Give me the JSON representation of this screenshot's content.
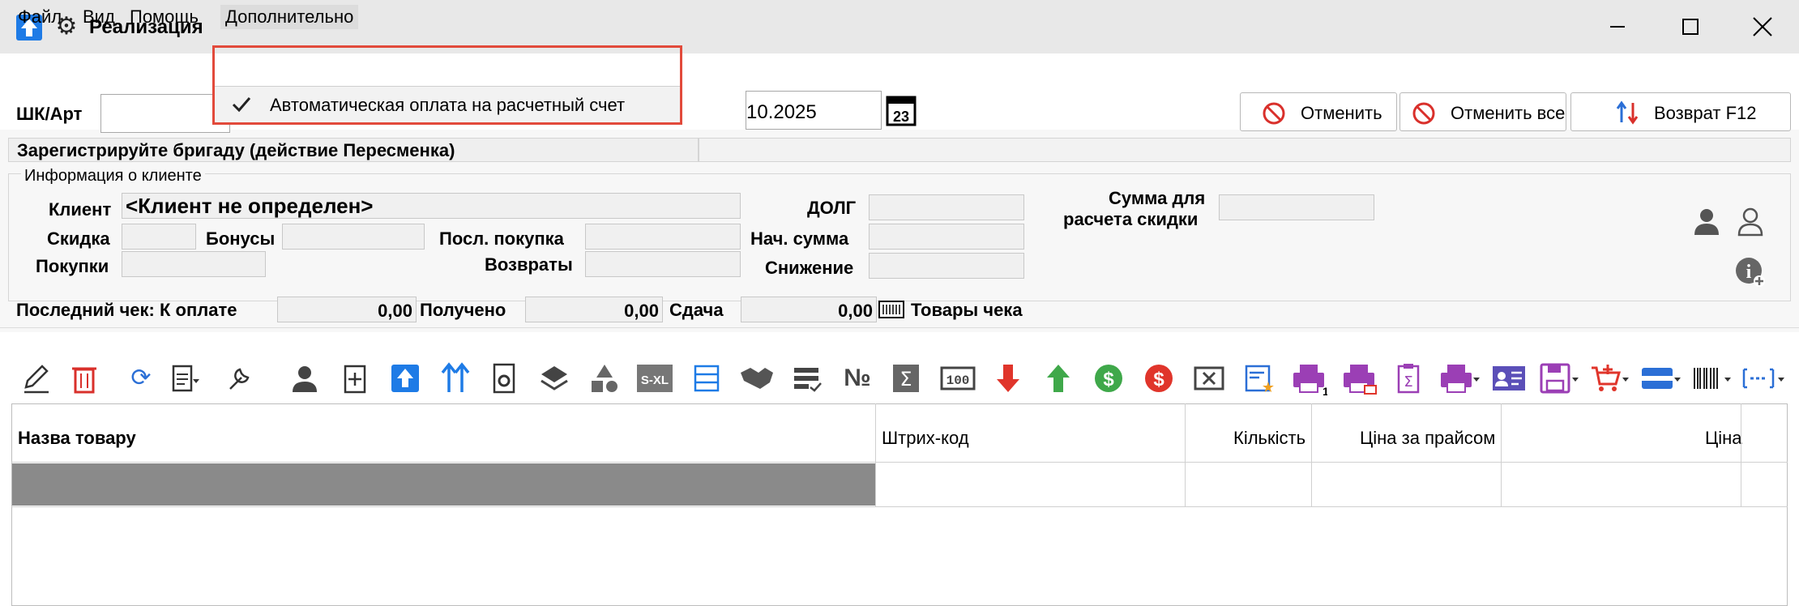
{
  "window": {
    "title": "Реализация"
  },
  "menu": {
    "items": [
      "Файл",
      "Вид",
      "Помощь",
      "Дополнительно"
    ],
    "dropdown_item": "Автоматическая оплата на расчетный счет"
  },
  "toolbar_top": {
    "barcode_label": "ШК/Арт",
    "date_value": "10.2025",
    "cancel_label": "Отменить",
    "cancel_all_label": "Отменить все",
    "return_label": "Возврат F12"
  },
  "status": {
    "message": "Зарегистрируйте бригаду (действие Пересменка)"
  },
  "client_info": {
    "group_title": "Информация о клиенте",
    "client_label": "Клиент",
    "client_value": "<Клиент не определен>",
    "discount_label": "Скидка",
    "bonus_label": "Бонусы",
    "last_purchase_label": "Посл. покупка",
    "purchases_label": "Покупки",
    "returns_label": "Возвраты",
    "debt_label": "ДОЛГ",
    "start_sum_label": "Нач. сумма",
    "reduction_label": "Снижение",
    "discount_sum_label_1": "Сумма для",
    "discount_sum_label_2": "расчета скидки"
  },
  "last_check": {
    "label": "Последний чек: К оплате",
    "to_pay": "0,00",
    "received_label": "Получено",
    "received": "0,00",
    "change_label": "Сдача",
    "change": "0,00",
    "goods_label": "Товары чека"
  },
  "table": {
    "columns": [
      "Назва товару",
      "Штрих-код",
      "Кількість",
      "Ціна за прайсом",
      "Ціна"
    ]
  },
  "toolbar_icons": [
    "edit-icon",
    "delete-icon",
    "refresh-icon",
    "document-icon",
    "wrench-icon",
    "user-icon",
    "add-document-icon",
    "upload-icon",
    "sort-icon",
    "settings-doc-icon",
    "layers-icon",
    "shapes-icon",
    "size-icon",
    "list-icon",
    "handshake-icon",
    "list-check-icon",
    "number-icon",
    "sum-icon",
    "counter-icon",
    "arrow-down-icon",
    "arrow-up-icon",
    "dollar-green-icon",
    "dollar-red-icon",
    "close-box-icon",
    "star-card-icon",
    "printer-1-icon",
    "printer-2-icon",
    "clipboard-icon",
    "printer-menu-icon",
    "id-card-icon",
    "save-icon",
    "cart-icon",
    "drive-icon",
    "barcode-icon",
    "dotted-icon"
  ],
  "colors": {
    "highlight": "#e24a3b",
    "accent": "#1e7be6",
    "selected_row": "#8a8a8a"
  }
}
